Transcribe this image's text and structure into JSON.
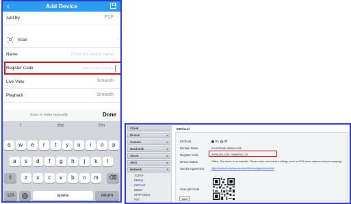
{
  "phone": {
    "header": {
      "back_icon": "chevron-left-icon",
      "title": "Add Device",
      "save_icon": "save-icon"
    },
    "rows": {
      "add_by": {
        "label": "Add By",
        "value": "P2P"
      },
      "scan": {
        "label": "Scan"
      },
      "name": {
        "label": "Name",
        "placeholder": "Enter the device name"
      },
      "register_code": {
        "label": "Register Code",
        "placeholder": "Sign in code on device"
      },
      "live_view": {
        "label": "Live View",
        "value": "Smooth"
      },
      "playback": {
        "label": "Playback",
        "value": "Smooth"
      }
    },
    "scan_bar": {
      "hint": "Scan or enter manually",
      "done": "Done"
    },
    "keyboard": {
      "suggestions": [
        "I",
        "the",
        "I'm"
      ],
      "row1": [
        "q",
        "w",
        "e",
        "r",
        "t",
        "y",
        "u",
        "i",
        "o",
        "p"
      ],
      "row2": [
        "a",
        "s",
        "d",
        "f",
        "g",
        "h",
        "j",
        "k",
        "l"
      ],
      "row3": [
        "z",
        "x",
        "c",
        "v",
        "b",
        "n",
        "m"
      ],
      "numbers": "123",
      "globe_icon": "globe-icon",
      "space": "space",
      "return": "return",
      "shift_icon": "shift-icon",
      "delete_icon": "backspace-icon"
    },
    "colors": {
      "header": "#2d9cf0",
      "highlight": "#b41620",
      "frame": "#2b3bd0"
    }
  },
  "web": {
    "sidebar": {
      "categories": [
        "Cloud",
        "Device",
        "Camera",
        "Hard Disk",
        "Alarm",
        "Alert",
        "Network"
      ],
      "network_items": [
        "TCP/IP",
        "PPPoE",
        "EZCloud",
        "DDNS",
        "UPnP Client",
        "Port"
      ]
    },
    "tab": "EZCloud",
    "fields": {
      "ezcloud": {
        "label": "EZCloud",
        "on": "On",
        "off": "Off"
      },
      "domain_name": {
        "label": "Domain Name",
        "value": "en.ezcloud.uniview.com"
      },
      "register_code": {
        "label": "Register Code",
        "value": "A9F6U0ZLA7M..RM6BRUG..W"
      },
      "device_status": {
        "label": "Device Status",
        "value": "Offline: The device is unreachable. Please make sure network settings (such as DNS server address and port mapping)"
      },
      "service_agreement": {
        "label": "Service Agreement",
        "value": "http://ezcloud.uniview.com/doc/ServiceAgreement.html"
      },
      "scan_qr": {
        "label": "Scan QR Code"
      }
    },
    "save": "Save"
  }
}
